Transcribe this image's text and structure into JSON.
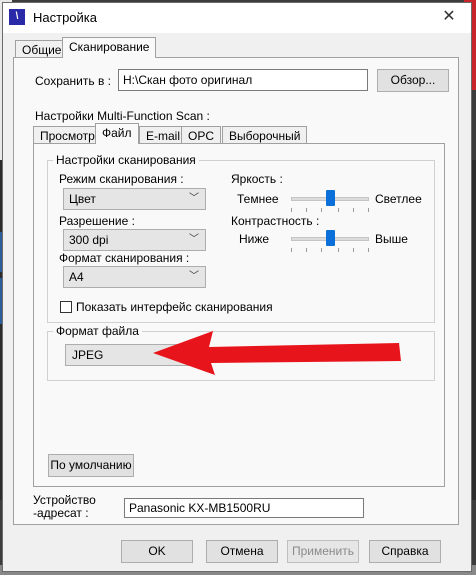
{
  "window": {
    "title": "Настройка",
    "close_icon": "close-icon",
    "app_icon_glyph": "\\"
  },
  "outer_tabs": [
    {
      "label": "Общие",
      "active": false
    },
    {
      "label": "Сканирование",
      "active": true
    }
  ],
  "save": {
    "label": "Сохранить в :",
    "path": "H:\\Скан фото оригинал",
    "browse_label": "Обзор..."
  },
  "mfs": {
    "label": "Настройки Multi-Function Scan :",
    "tabs": [
      {
        "label": "Просмотр",
        "active": false
      },
      {
        "label": "Файл",
        "active": true
      },
      {
        "label": "E-mail",
        "active": false
      },
      {
        "label": "OPC",
        "active": false
      },
      {
        "label": "Выборочный",
        "active": false
      }
    ]
  },
  "scan_settings": {
    "group_title": "Настройки сканирования",
    "mode_label": "Режим сканирования :",
    "mode_value": "Цвет",
    "resolution_label": "Разрешение :",
    "resolution_value": "300 dpi",
    "format_label": "Формат сканирования :",
    "format_value": "A4",
    "brightness_label": "Яркость :",
    "brightness_min": "Темнее",
    "brightness_max": "Светлее",
    "brightness_level": 0.5,
    "contrast_label": "Контрастность :",
    "contrast_min": "Ниже",
    "contrast_max": "Выше",
    "contrast_level": 0.5,
    "show_interface_label": "Показать интерфейс сканирования",
    "show_interface_checked": false
  },
  "file_format": {
    "group_title": "Формат файла",
    "value": "JPEG"
  },
  "default_button": "По умолчанию",
  "device": {
    "label_line1": "Устройство",
    "label_line2": "-адресат :",
    "value": "Panasonic KX-MB1500RU"
  },
  "buttons": {
    "ok": "OK",
    "cancel": "Отмена",
    "apply": "Применить",
    "help": "Справка"
  },
  "annotation": {
    "arrow_color": "#e8141b"
  }
}
